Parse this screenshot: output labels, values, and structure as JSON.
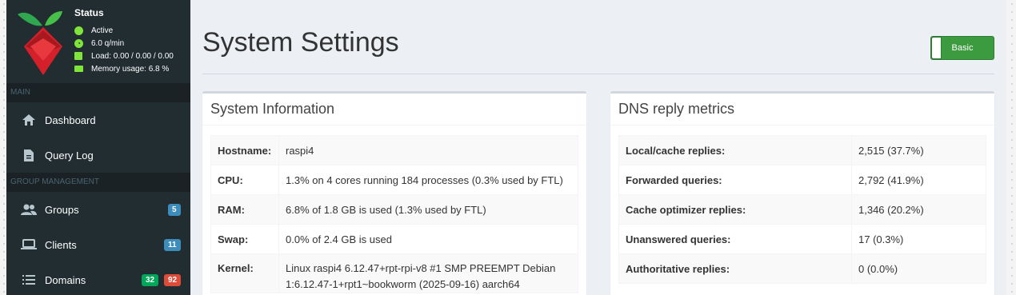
{
  "status": {
    "title": "Status",
    "items": [
      {
        "text": "Active",
        "icon": "circle-icon",
        "color": "#7fe53b"
      },
      {
        "text": "6.0 q/min",
        "icon": "gauge-icon",
        "color": "#7fe53b"
      },
      {
        "text": "Load:  0.00 / 0.00 / 0.00",
        "icon": "cpu-icon",
        "color": "#7fe53b"
      },
      {
        "text": "Memory usage:  6.8 %",
        "icon": "memory-icon",
        "color": "#7fe53b"
      }
    ]
  },
  "sidebar": {
    "main_header": "MAIN",
    "group_header": "GROUP MANAGEMENT",
    "dashboard": "Dashboard",
    "query_log": "Query Log",
    "groups": "Groups",
    "groups_badge": "5",
    "clients": "Clients",
    "clients_badge": "11",
    "domains": "Domains",
    "domains_badge_allow": "32",
    "domains_badge_deny": "92"
  },
  "page": {
    "title": "System Settings",
    "mode_button": "Basic"
  },
  "system_info": {
    "title": "System Information",
    "rows": [
      {
        "label": "Hostname:",
        "value": "raspi4"
      },
      {
        "label": "CPU:",
        "value": "1.3% on 4 cores running 184 processes (0.3% used by FTL)"
      },
      {
        "label": "RAM:",
        "value": "6.8% of 1.8 GB is used (1.3% used by FTL)"
      },
      {
        "label": "Swap:",
        "value": "0.0% of 2.4 GB is used"
      },
      {
        "label": "Kernel:",
        "value_line1": "Linux raspi4 6.12.47+rpt-rpi-v8 #1 SMP PREEMPT Debian",
        "value_line2": "1:6.12.47-1+rpt1~bookworm (2025-09-16) aarch64"
      }
    ]
  },
  "dns_metrics": {
    "title": "DNS reply metrics",
    "rows": [
      {
        "label": "Local/cache replies:",
        "value": "2,515 (37.7%)"
      },
      {
        "label": "Forwarded queries:",
        "value": "2,792 (41.9%)"
      },
      {
        "label": "Cache optimizer replies:",
        "value": "1,346 (20.2%)"
      },
      {
        "label": "Unanswered queries:",
        "value": "17 (0.3%)"
      },
      {
        "label": "Authoritative replies:",
        "value": "0 (0.0%)"
      }
    ]
  },
  "colors": {
    "sidebar_bg": "#222d32",
    "content_bg": "#ecf0f5",
    "accent_green": "#3c9a3f",
    "badge_blue": "#3c8dbc",
    "badge_green": "#00a65a",
    "badge_red": "#dd4b39"
  }
}
